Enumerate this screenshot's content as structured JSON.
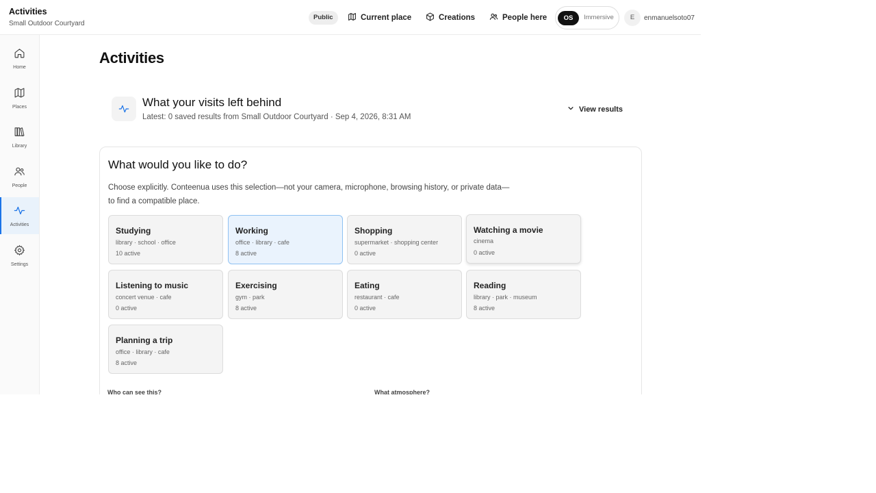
{
  "header": {
    "title": "Activities",
    "subtitle": "Small Outdoor Courtyard",
    "visibility_badge": "Public",
    "nav": [
      {
        "label": "Current place",
        "icon": "map-icon"
      },
      {
        "label": "Creations",
        "icon": "cube-icon"
      },
      {
        "label": "People here",
        "icon": "people-icon"
      }
    ],
    "mode_os": "OS",
    "mode_immersive": "Immersive",
    "avatar_initial": "E",
    "username": "enmanuelsoto07"
  },
  "sidebar": {
    "items": [
      {
        "label": "Home",
        "icon": "home-icon",
        "active": false
      },
      {
        "label": "Places",
        "icon": "map-icon",
        "active": false
      },
      {
        "label": "Library",
        "icon": "library-icon",
        "active": false
      },
      {
        "label": "People",
        "icon": "people-icon",
        "active": false
      },
      {
        "label": "Activities",
        "icon": "activity-icon",
        "active": true
      },
      {
        "label": "Settings",
        "icon": "gear-icon",
        "active": false
      }
    ]
  },
  "main": {
    "page_title": "Activities",
    "visits": {
      "title": "What your visits left behind",
      "subtitle": "Latest: 0 saved results from Small Outdoor Courtyard · Sep 4, 2026, 8:31 AM",
      "toggle_label": "View results"
    },
    "panel": {
      "title": "What would you like to do?",
      "description": "Choose explicitly. Conteenua uses this selection—not your camera, microphone, browsing history, or private data—to find a compatible place.",
      "activities": [
        {
          "name": "Studying",
          "tags": "library · school · office",
          "count": "10 active"
        },
        {
          "name": "Working",
          "tags": "office · library · cafe",
          "count": "8 active",
          "selected": true
        },
        {
          "name": "Shopping",
          "tags": "supermarket · shopping center",
          "count": "0 active"
        },
        {
          "name": "Watching a movie",
          "tags": "cinema",
          "count": "0 active"
        },
        {
          "name": "Listening to music",
          "tags": "concert venue · cafe",
          "count": "0 active"
        },
        {
          "name": "Exercising",
          "tags": "gym · park",
          "count": "8 active"
        },
        {
          "name": "Eating",
          "tags": "restaurant · cafe",
          "count": "0 active"
        },
        {
          "name": "Reading",
          "tags": "library · park · museum",
          "count": "8 active"
        },
        {
          "name": "Planning a trip",
          "tags": "office · library · cafe",
          "count": "8 active"
        }
      ],
      "who_label": "Who can see this?",
      "atmosphere_label": "What atmosphere?"
    }
  },
  "colors": {
    "accent": "#1a73e8",
    "selected_card_bg": "#eaf3fd",
    "selected_card_border": "#8ec1f2"
  }
}
